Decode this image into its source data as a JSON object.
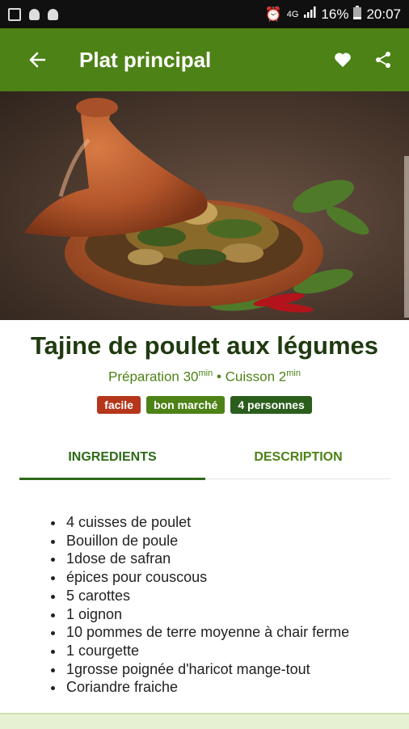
{
  "status_bar": {
    "network": "4G",
    "battery": "16%",
    "time": "20:07"
  },
  "appbar": {
    "title": "Plat principal"
  },
  "recipe": {
    "title": "Tajine de poulet aux légumes",
    "prep_label": "Préparation 30",
    "prep_unit": "min",
    "separator": " • ",
    "cook_label": "Cuisson 2",
    "cook_unit": "min",
    "badges": [
      {
        "label": "facile",
        "color": "#b5361b"
      },
      {
        "label": "bon marché",
        "color": "#4d8216"
      },
      {
        "label": "4 personnes",
        "color": "#2b5e1c"
      }
    ]
  },
  "tabs": [
    {
      "label": "INGREDIENTS",
      "active": true
    },
    {
      "label": "DESCRIPTION",
      "active": false
    }
  ],
  "ingredients": [
    "4 cuisses de poulet",
    "Bouillon de poule",
    "1dose de safran",
    "épices pour couscous",
    "5 carottes",
    "1 oignon",
    "10 pommes de terre moyenne à chair ferme",
    "1 courgette",
    "1grosse poignée d'haricot mange-tout",
    "Coriandre fraiche"
  ],
  "colors": {
    "primary": "#4d8216",
    "title_dark": "#1f3a10"
  }
}
